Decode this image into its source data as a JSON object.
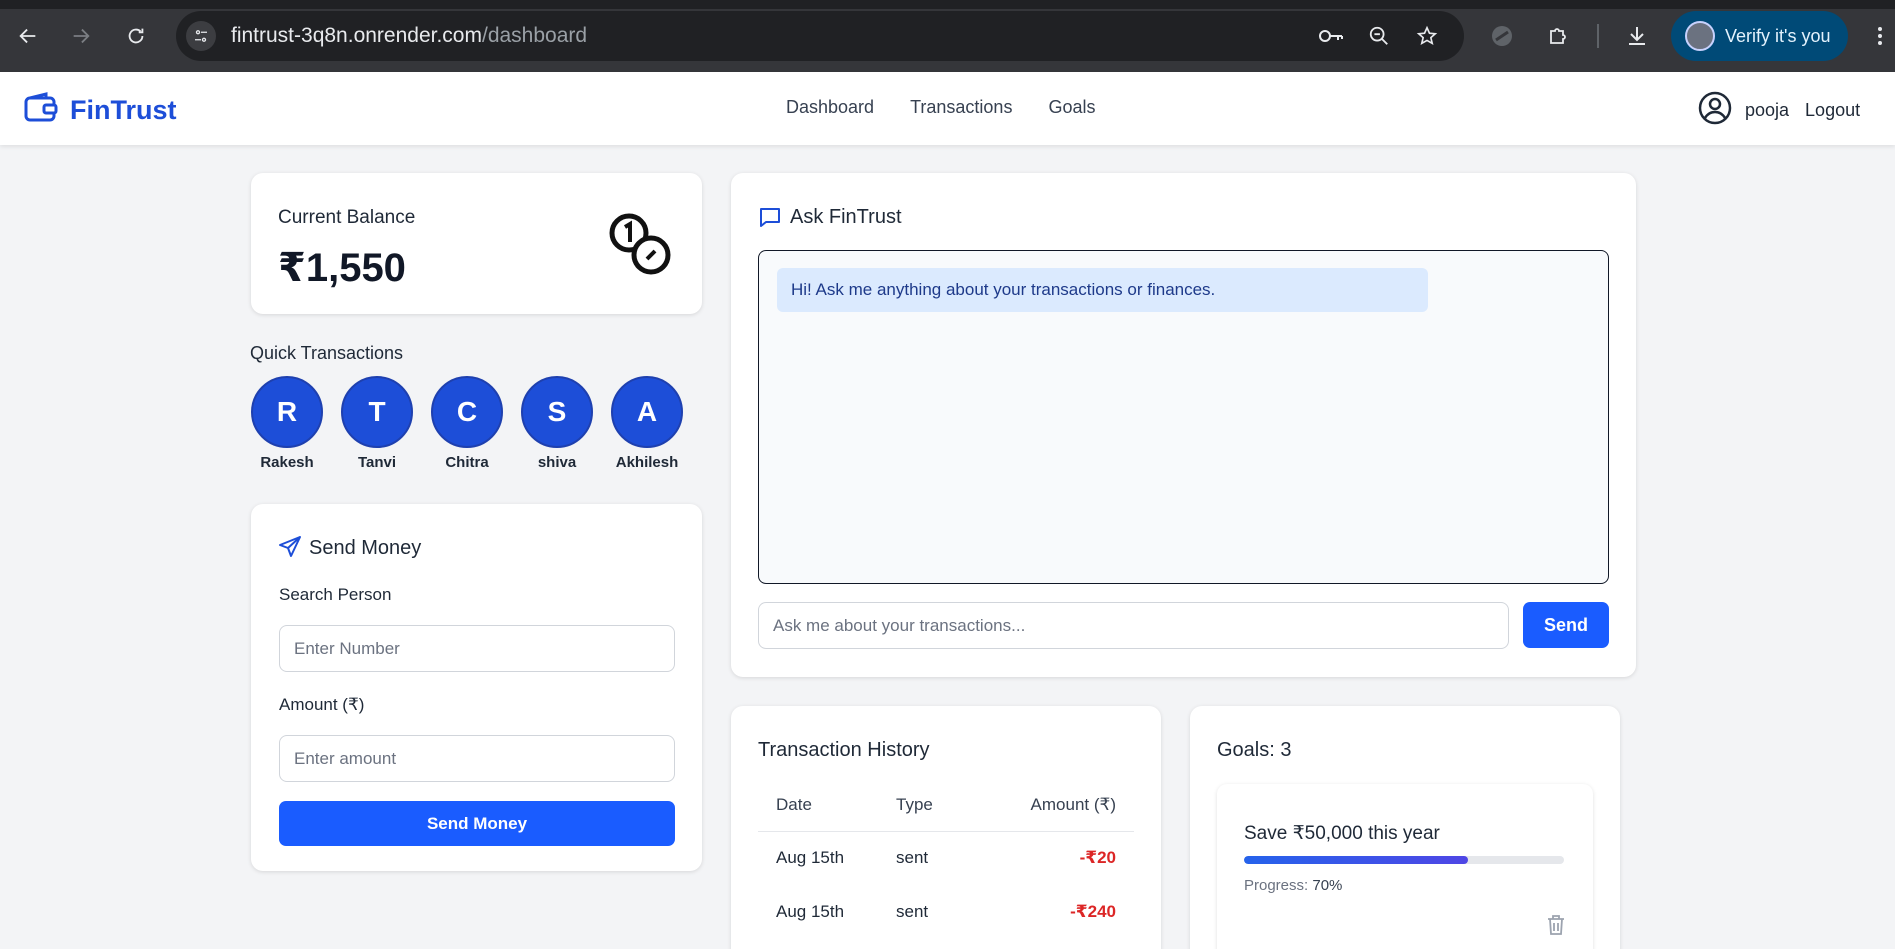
{
  "browser": {
    "url_host": "fintrust-3q8n.onrender.com",
    "url_path": "/dashboard",
    "profile_label": "Verify it's you",
    "icons": [
      "back-icon",
      "forward-icon",
      "reload-icon",
      "site-info-icon",
      "password-key-icon",
      "zoom-out-icon",
      "bookmark-star-icon",
      "extension-disabled-icon",
      "extensions-puzzle-icon",
      "download-icon",
      "more-menu-icon"
    ]
  },
  "navbar": {
    "brand": "FinTrust",
    "links": [
      "Dashboard",
      "Transactions",
      "Goals"
    ],
    "username": "pooja",
    "logout": "Logout"
  },
  "balance": {
    "label": "Current Balance",
    "value": "₹1,550"
  },
  "quick_transactions": {
    "title": "Quick Transactions",
    "contacts": [
      {
        "initial": "R",
        "name": "Rakesh"
      },
      {
        "initial": "T",
        "name": "Tanvi"
      },
      {
        "initial": "C",
        "name": "Chitra"
      },
      {
        "initial": "S",
        "name": "shiva"
      },
      {
        "initial": "A",
        "name": "Akhilesh"
      }
    ]
  },
  "send_money": {
    "title": "Send Money",
    "search_label": "Search Person",
    "search_placeholder": "Enter Number",
    "amount_label": "Amount (₹)",
    "amount_placeholder": "Enter amount",
    "button": "Send Money"
  },
  "ask": {
    "title": "Ask FinTrust",
    "greeting": "Hi! Ask me anything about your transactions or finances.",
    "input_placeholder": "Ask me about your transactions...",
    "send": "Send"
  },
  "transactions": {
    "title": "Transaction History",
    "columns": [
      "Date",
      "Type",
      "Amount (₹)"
    ],
    "rows": [
      {
        "date": "Aug 15th",
        "type": "sent",
        "amount": "-₹20"
      },
      {
        "date": "Aug 15th",
        "type": "sent",
        "amount": "-₹240"
      }
    ]
  },
  "goals": {
    "title": "Goals: 3",
    "items": [
      {
        "name": "Save ₹50,000 this year",
        "progress_label": "Progress:",
        "progress_value": "70%",
        "progress": 0.7
      }
    ]
  },
  "colors": {
    "brand": "#1d4ed8",
    "button": "#1a5cff",
    "negative": "#dc2626"
  }
}
